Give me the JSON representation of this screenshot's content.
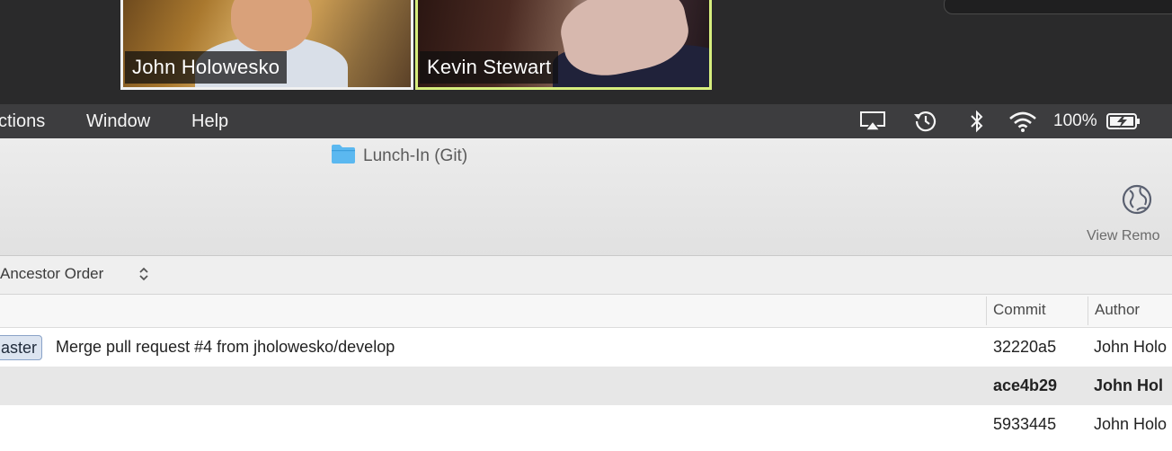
{
  "zoom": {
    "participants": [
      {
        "name": "John Holowesko",
        "speaking": false
      },
      {
        "name": "Kevin Stewart",
        "speaking": true
      }
    ],
    "speaking_border_color": "#d7ee7e"
  },
  "menubar": {
    "items": [
      "ctions",
      "Window",
      "Help"
    ],
    "status": {
      "icons": [
        "airplay-icon",
        "time-machine-icon",
        "bluetooth-icon",
        "wifi-icon",
        "battery-icon"
      ],
      "battery_percent": "100%"
    }
  },
  "window": {
    "title": "Lunch-In (Git)",
    "folder_icon_color": "#5bb8f0",
    "toolbar": {
      "view_remote_label": "View Remo"
    }
  },
  "history": {
    "ordering": "Ancestor Order",
    "columns": [
      "Commit",
      "Author"
    ],
    "rows": [
      {
        "branch": "aster",
        "message": "Merge pull request #4 from jholowesko/develop",
        "commit": "32220a5",
        "author": "John Holо",
        "bold": false
      },
      {
        "branch": "",
        "message": "",
        "commit": "ace4b29",
        "author": "John Hol",
        "bold": true
      },
      {
        "branch": "",
        "message": "",
        "commit": "5933445",
        "author": "John Holo",
        "bold": false
      }
    ]
  }
}
